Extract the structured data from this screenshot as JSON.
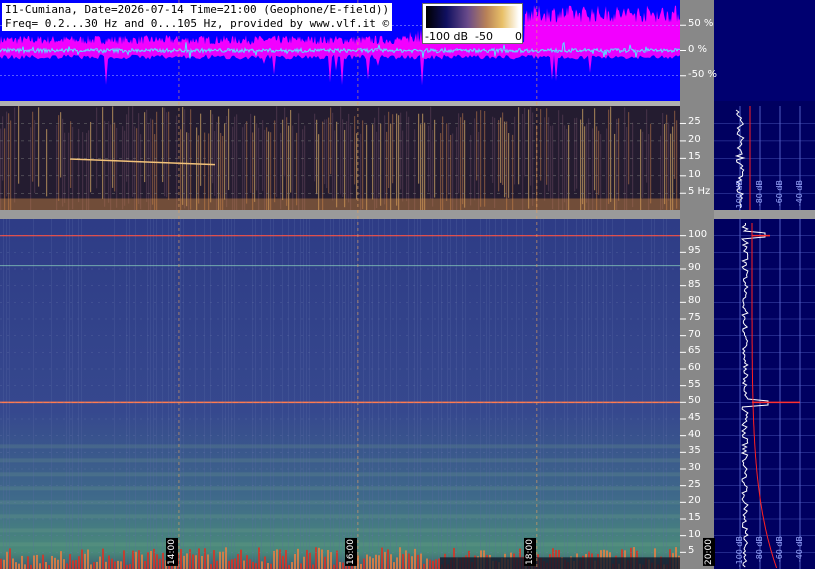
{
  "header": {
    "line1": "I1-Cumiana, Date=2026-07-14 Time=21:00 (Geophone/E-field))",
    "line2": "Freq= 0.2...30 Hz and 0...105 Hz, provided by www.vlf.it ©"
  },
  "colorbar": {
    "labels": [
      "-100 dB",
      "-50",
      "0"
    ]
  },
  "colors": {
    "amp_bg": "#0000ff",
    "magenta": "#ff00ff",
    "cyan_trace": "#55e0ff",
    "grid": "#8899ff",
    "spec_bg": "#2a3a7a"
  },
  "chart_data": [
    {
      "type": "line",
      "name": "amplitude",
      "y_ticks": [
        {
          "value": 50,
          "label": "50 %"
        },
        {
          "value": 0,
          "label": "0 %"
        },
        {
          "value": -50,
          "label": "-50 %"
        }
      ],
      "ylim": [
        -100,
        100
      ]
    },
    {
      "type": "heatmap",
      "name": "spectrogram-low",
      "y_ticks": [
        {
          "value": 25,
          "label": "25"
        },
        {
          "value": 20,
          "label": "20"
        },
        {
          "value": 15,
          "label": "15"
        },
        {
          "value": 10,
          "label": "10"
        },
        {
          "value": 5,
          "label": "5 Hz"
        }
      ],
      "ylim": [
        0.2,
        30
      ]
    },
    {
      "type": "heatmap",
      "name": "spectrogram-high",
      "y_ticks": [
        {
          "value": 100,
          "label": "100"
        },
        {
          "value": 95,
          "label": "95"
        },
        {
          "value": 90,
          "label": "90"
        },
        {
          "value": 85,
          "label": "85"
        },
        {
          "value": 80,
          "label": "80"
        },
        {
          "value": 75,
          "label": "75"
        },
        {
          "value": 70,
          "label": "70"
        },
        {
          "value": 65,
          "label": "65"
        },
        {
          "value": 60,
          "label": "60"
        },
        {
          "value": 55,
          "label": "55"
        },
        {
          "value": 50,
          "label": "50"
        },
        {
          "value": 45,
          "label": "45"
        },
        {
          "value": 40,
          "label": "40"
        },
        {
          "value": 35,
          "label": "35"
        },
        {
          "value": 30,
          "label": "30"
        },
        {
          "value": 25,
          "label": "25"
        },
        {
          "value": 20,
          "label": "20"
        },
        {
          "value": 15,
          "label": "15"
        },
        {
          "value": 10,
          "label": "10"
        },
        {
          "value": 5,
          "label": "5"
        }
      ],
      "ylim": [
        0,
        105
      ],
      "lines_hz": [
        100,
        91,
        50
      ]
    },
    {
      "type": "line",
      "name": "time-axis",
      "x_ticks": [
        {
          "value": 14,
          "label": "14:00"
        },
        {
          "value": 16,
          "label": "16:00"
        },
        {
          "value": 18,
          "label": "18:00"
        },
        {
          "value": 20,
          "label": "20:00"
        }
      ],
      "xlim": [
        12,
        19.6
      ]
    },
    {
      "type": "line",
      "name": "spectrum-profile",
      "db_labels": [
        "-40 dB",
        "-60 dB",
        "-80 dB",
        "-100 dB"
      ]
    }
  ]
}
